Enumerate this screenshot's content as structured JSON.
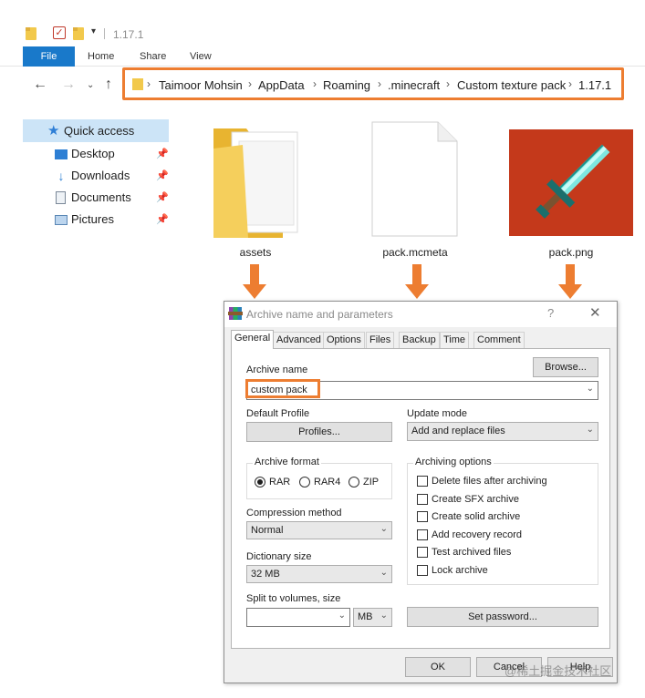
{
  "explorer": {
    "title_path": "1.17.1",
    "ribbon": {
      "file": "File",
      "home": "Home",
      "share": "Share",
      "view": "View"
    },
    "breadcrumb": [
      "Taimoor Mohsin",
      "AppData",
      "Roaming",
      ".minecraft",
      "Custom texture pack",
      "1.17.1"
    ],
    "quick_access": "Quick access",
    "nav_items": [
      {
        "label": "Desktop",
        "icon": "desktop-icon"
      },
      {
        "label": "Downloads",
        "icon": "downloads-icon"
      },
      {
        "label": "Documents",
        "icon": "documents-icon"
      },
      {
        "label": "Pictures",
        "icon": "pictures-icon"
      }
    ],
    "files": [
      {
        "name": "assets",
        "icon": "folder-icon"
      },
      {
        "name": "pack.mcmeta",
        "icon": "file-icon"
      },
      {
        "name": "pack.png",
        "icon": "diamond-sword-icon"
      }
    ]
  },
  "dialog": {
    "title": "Archive name and parameters",
    "help": "?",
    "close": "✕",
    "tabs": [
      "General",
      "Advanced",
      "Options",
      "Files",
      "Backup",
      "Time",
      "Comment"
    ],
    "active_tab": "General",
    "archive_name_label": "Archive name",
    "browse": "Browse...",
    "archive_name_value": "custom pack",
    "default_profile_label": "Default Profile",
    "profiles_button": "Profiles...",
    "update_mode_label": "Update mode",
    "update_mode_value": "Add and replace files",
    "archive_format_label": "Archive format",
    "formats": [
      "RAR",
      "RAR4",
      "ZIP"
    ],
    "selected_format": "RAR",
    "archiving_options_label": "Archiving options",
    "options": [
      {
        "label": "Delete files after archiving",
        "checked": false
      },
      {
        "label": "Create SFX archive",
        "checked": false
      },
      {
        "label": "Create solid archive",
        "checked": false
      },
      {
        "label": "Add recovery record",
        "checked": false
      },
      {
        "label": "Test archived files",
        "checked": false
      },
      {
        "label": "Lock archive",
        "checked": false
      }
    ],
    "compression_label": "Compression method",
    "compression_value": "Normal",
    "dictionary_label": "Dictionary size",
    "dictionary_value": "32 MB",
    "split_label": "Split to volumes, size",
    "split_value": "",
    "split_unit": "MB",
    "set_password": "Set password...",
    "ok": "OK",
    "cancel": "Cancel",
    "help_button": "Help"
  },
  "watermark": "@稀土掘金技术社区",
  "colors": {
    "highlight": "#ed7d31",
    "accent": "#1979ca",
    "selection": "#cce4f7"
  }
}
